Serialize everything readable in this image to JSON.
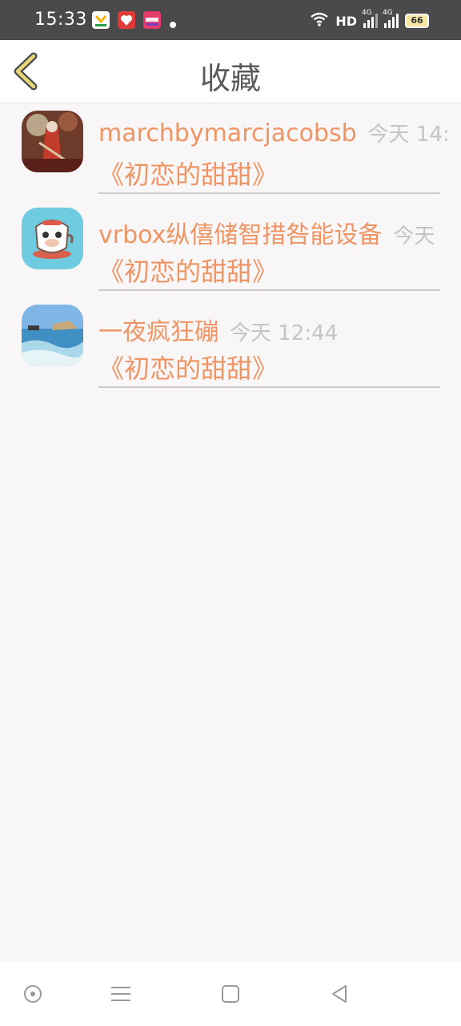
{
  "status_bar": {
    "time": "15:33",
    "hd_label": "HD",
    "network_1": "4G",
    "network_2": "4G",
    "battery": "66"
  },
  "header": {
    "title": "收藏",
    "back_icon": "chevron-left-icon"
  },
  "favorites": [
    {
      "name": "marchbymarcjacobsb",
      "time": "今天 14:",
      "snippet": "《初恋的甜甜》",
      "avatar": "avatar-red-figure"
    },
    {
      "name": "vrbox纵僖储智措咎能设备",
      "time": "今天",
      "snippet": "《初恋的甜甜》",
      "avatar": "avatar-cartoon-monkey"
    },
    {
      "name": "一夜疯狂磞",
      "time": "今天 12:44",
      "snippet": "《初恋的甜甜》",
      "avatar": "avatar-seaside"
    }
  ],
  "colors": {
    "accent": "#ef9564",
    "time_gray": "#c4c4c4",
    "back_arrow": "#e8d77a"
  },
  "nav_bar": {
    "icons": [
      "circle-dot-icon",
      "menu-icon",
      "square-icon",
      "back-triangle-icon"
    ]
  }
}
